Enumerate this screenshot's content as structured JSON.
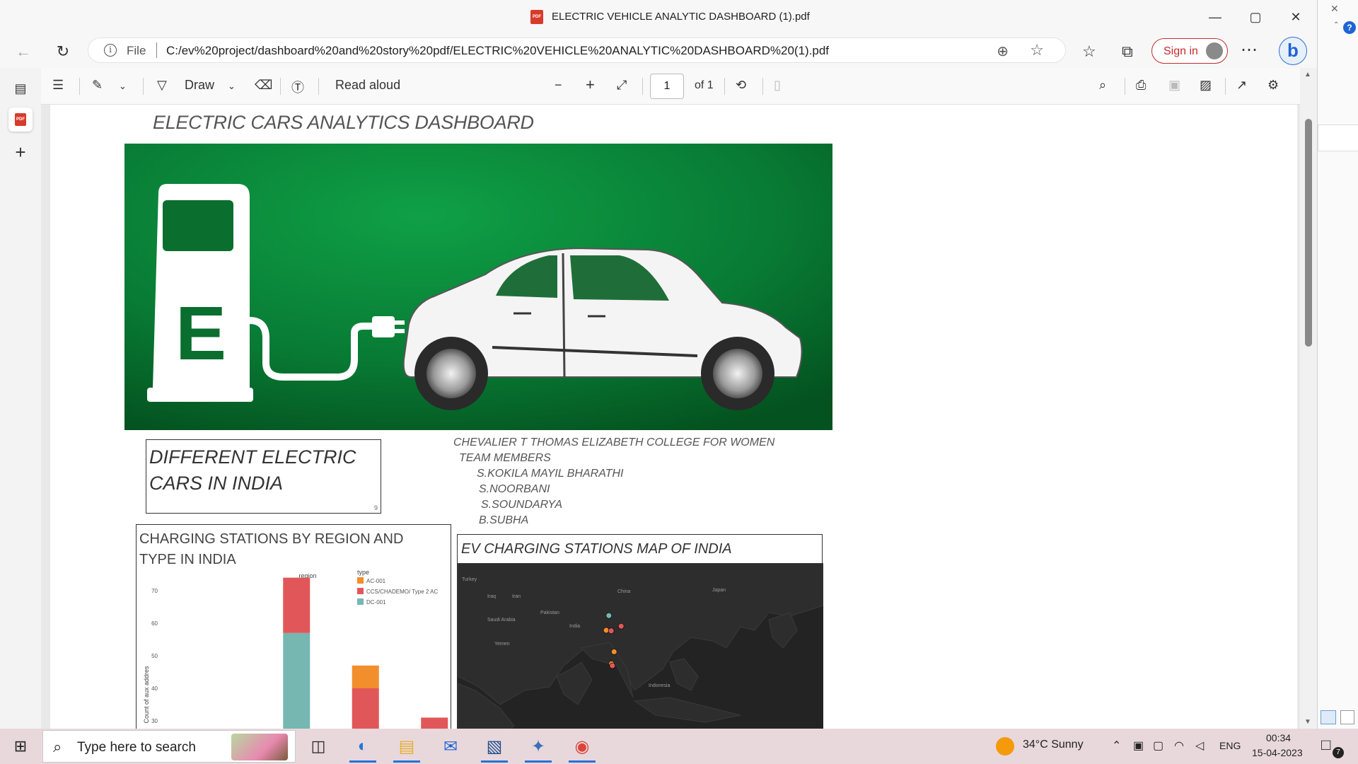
{
  "window": {
    "title": "ELECTRIC VEHICLE ANALYTIC DASHBOARD (1).pdf"
  },
  "addressbar": {
    "scheme_label": "File",
    "url": "C:/ev%20project/dashboard%20and%20story%20pdf/ELECTRIC%20VEHICLE%20ANALYTIC%20DASHBOARD%20(1).pdf",
    "signin_label": "Sign in"
  },
  "pdf_toolbar": {
    "draw_label": "Draw",
    "read_aloud_label": "Read aloud",
    "page_current": "1",
    "page_total": "of 1"
  },
  "document": {
    "title": "ELECTRIC CARS ANALYTICS DASHBOARD",
    "banner_letter": "E",
    "cars_box": {
      "title": "DIFFERENT ELECTRIC CARS IN INDIA",
      "footnote": "9"
    },
    "credits": {
      "college": "CHEVALIER T THOMAS ELIZABETH COLLEGE FOR WOMEN",
      "team_label": "TEAM MEMBERS",
      "members": [
        "S.KOKILA MAYIL BHARATHI",
        "S.NOORBANI",
        "S.SOUNDARYA",
        "B.SUBHA"
      ]
    },
    "charging_box": {
      "title": "CHARGING STATIONS BY REGION AND TYPE IN INDIA"
    },
    "map_box": {
      "title": "EV CHARGING STATIONS MAP OF INDIA",
      "labels": [
        "Turkey",
        "Iraq",
        "Iran",
        "China",
        "Japan",
        "Pakistan",
        "Saudi Arabia",
        "India",
        "Yemen",
        "Indonesia"
      ]
    }
  },
  "chart_data": {
    "type": "bar",
    "stacked": true,
    "column_header": "region",
    "legend_title": "type",
    "legend_position": "top-right",
    "ylabel": "Count of aux addres",
    "yticks": [
      30,
      40,
      50,
      60,
      70
    ],
    "ylim": [
      25,
      75
    ],
    "categories": [
      "",
      "",
      "",
      ""
    ],
    "series": [
      {
        "name": "AC-001",
        "color": "#f28e2b",
        "values": [
          0,
          0,
          7,
          0
        ]
      },
      {
        "name": "CCS/CHADEMO/ Type 2 AC",
        "color": "#e15759",
        "values": [
          0,
          17,
          40,
          31
        ]
      },
      {
        "name": "DC-001",
        "color": "#76b7b2",
        "values": [
          0,
          57,
          0,
          0
        ]
      }
    ]
  },
  "map_points": [
    {
      "lat": 30.7,
      "lon": 76.7,
      "color": "#76b7b2"
    },
    {
      "lat": 26.8,
      "lon": 80.9,
      "color": "#e15759"
    },
    {
      "lat": 25.3,
      "lon": 75.8,
      "color": "#f28e2b"
    },
    {
      "lat": 25.1,
      "lon": 77.5,
      "color": "#e15759"
    },
    {
      "lat": 17.4,
      "lon": 78.5,
      "color": "#f28e2b"
    },
    {
      "lat": 13.0,
      "lon": 77.6,
      "color": "#f28e2b"
    },
    {
      "lat": 12.3,
      "lon": 77.9,
      "color": "#e15759"
    }
  ],
  "taskbar": {
    "search_placeholder": "Type here to search",
    "weather": "34°C  Sunny",
    "language": "ENG",
    "time": "00:34",
    "date": "15-04-2023",
    "notification_count": "7"
  }
}
